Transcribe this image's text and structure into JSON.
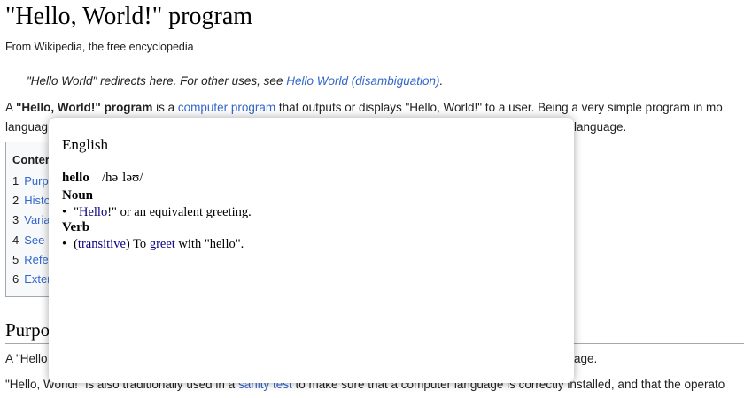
{
  "article": {
    "title": "\"Hello, World!\" program",
    "tagline": "From Wikipedia, the free encyclopedia",
    "hatnote": {
      "text": "\"Hello World\" redirects here. For other uses, see ",
      "link": "Hello World (disambiguation)",
      "end": "."
    },
    "intro": {
      "a": "A ",
      "bold": "\"Hello, World!\" program",
      "b": " is a ",
      "link": "computer program",
      "c": " that outputs or displays \"Hello, World!\" to a user. Being a very simple program in mo",
      "line2_start": "languag",
      "line2_end": "language."
    },
    "toc": {
      "title": "Conter",
      "items": [
        {
          "num": "1",
          "label": "Purp"
        },
        {
          "num": "2",
          "label": "Histo"
        },
        {
          "num": "3",
          "label": "Varia"
        },
        {
          "num": "4",
          "label": "See"
        },
        {
          "num": "5",
          "label": "Refe"
        },
        {
          "num": "6",
          "label": "Exter"
        }
      ]
    },
    "section_heading": "Purpo",
    "p2": {
      "start": "A \"Hello",
      "end": "age."
    },
    "p3": {
      "a": "\"Hello, World!\" is also traditionally used in a ",
      "link": "sanity test",
      "b": " to make sure that a computer language is correctly installed, and that the operato"
    }
  },
  "popup": {
    "language": "English",
    "word": "hello",
    "ipa": "/həˈləʊ/",
    "senses": [
      {
        "pos": "Noun",
        "pre": "\"",
        "link": "Hello",
        "post": "!\" or an equivalent greeting."
      },
      {
        "pos": "Verb",
        "pre": "(",
        "link": "transitive",
        "mid": ") To ",
        "link2": "greet",
        "post": " with \"hello\"."
      }
    ]
  }
}
